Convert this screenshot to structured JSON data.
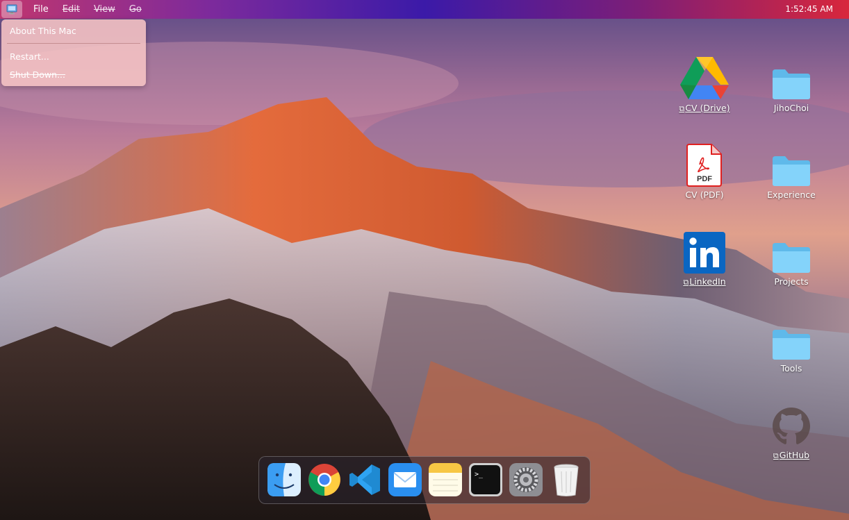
{
  "menubar": {
    "apple_icon": "computer-icon",
    "items": [
      {
        "label": "File",
        "disabled": false
      },
      {
        "label": "Edit",
        "disabled": true
      },
      {
        "label": "View",
        "disabled": true
      },
      {
        "label": "Go",
        "disabled": true
      }
    ],
    "clock": "1:52:45 AM"
  },
  "apple_menu": {
    "about": "About This Mac",
    "restart": "Restart...",
    "shutdown": "Shut Down..."
  },
  "desktop": {
    "icons": [
      {
        "label": "CV (Drive)",
        "icon": "google-drive-icon",
        "external": true
      },
      {
        "label": "JihoChoi",
        "icon": "folder-icon",
        "external": false
      },
      {
        "label": "CV (PDF)",
        "icon": "pdf-icon",
        "external": false
      },
      {
        "label": "Experience",
        "icon": "folder-icon",
        "external": false
      },
      {
        "label": "LinkedIn",
        "icon": "linkedin-icon",
        "external": true
      },
      {
        "label": "Projects",
        "icon": "folder-icon",
        "external": false
      },
      {
        "label": "Tools",
        "icon": "folder-icon",
        "external": false
      },
      {
        "label": "GitHub",
        "icon": "github-icon",
        "external": true
      }
    ],
    "pdf_badge": "PDF",
    "external_glyph": "⧉"
  },
  "dock": {
    "apps": [
      "finder-icon",
      "chrome-icon",
      "vscode-icon",
      "mail-icon",
      "notes-icon",
      "terminal-icon",
      "system-preferences-icon",
      "trash-icon"
    ],
    "terminal_prompt": ">_"
  },
  "colors": {
    "menubar_left": "#c0366f",
    "menubar_mid": "#3b1aa8",
    "menubar_right": "#d8273c",
    "folder": "#7fd0f7",
    "linkedin": "#0a66c2",
    "pdf_red": "#e02020"
  }
}
